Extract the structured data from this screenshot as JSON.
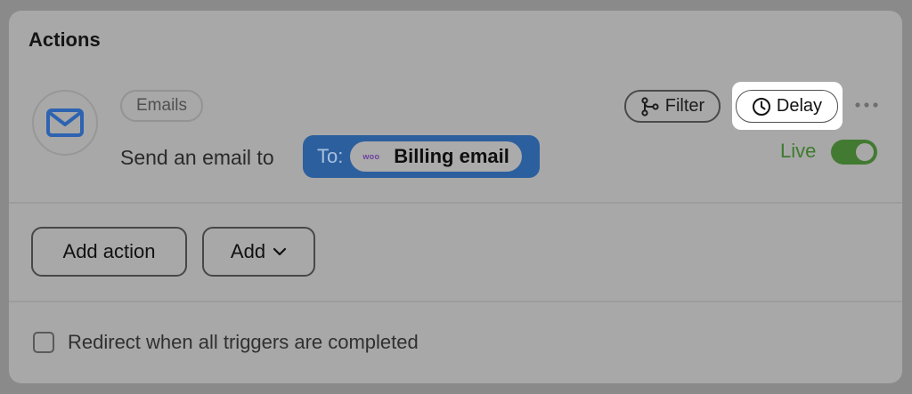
{
  "actions": {
    "title": "Actions",
    "item": {
      "icon": "envelope-icon",
      "category_chip": "Emails",
      "description": "Send an email to",
      "recipient": {
        "prefix": "To:",
        "source_logo": "woo",
        "label": "Billing email"
      },
      "filter_label": "Filter",
      "delay_label": "Delay",
      "status_label": "Live",
      "status_on": true
    },
    "add_action_label": "Add action",
    "add_label": "Add",
    "redirect_label": "Redirect when all triggers are completed"
  },
  "colors": {
    "accent_blue": "#2c5f9e",
    "live_green": "#427a31",
    "envelope_blue": "#2d63b1",
    "woo_purple": "#6b3fa0"
  }
}
